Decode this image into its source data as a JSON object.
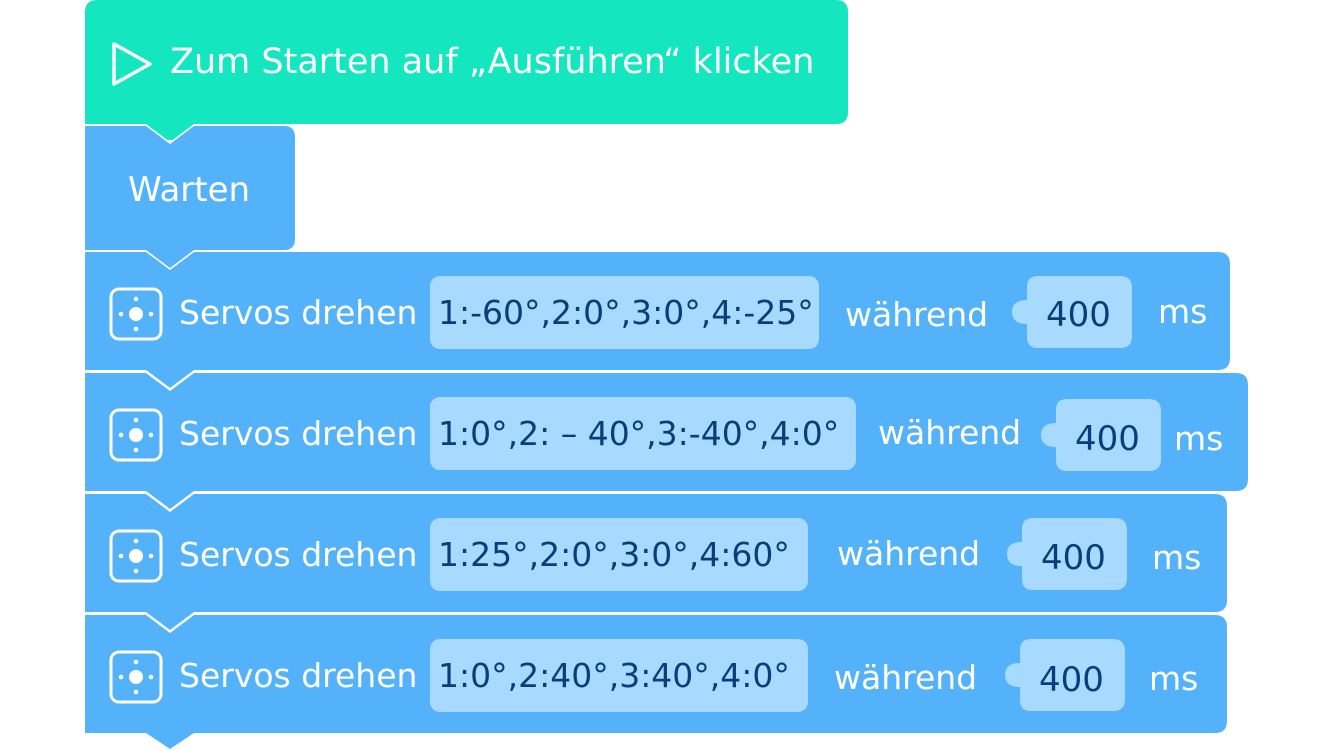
{
  "start_block": {
    "label": "Zum Starten auf „Ausführen“ klicken",
    "icon": "play-icon"
  },
  "wait_block": {
    "label": "Warten"
  },
  "servo_blocks": [
    {
      "label": "Servos drehen",
      "angles": "1:-60°,2:0°,3:0°,4:-25°",
      "during": "während",
      "duration": "400",
      "unit": "ms"
    },
    {
      "label": "Servos drehen",
      "angles": "1:0°,2: – 40°,3:-40°,4:0°",
      "during": "während",
      "duration": "400",
      "unit": "ms"
    },
    {
      "label": "Servos drehen",
      "angles": "1:25°,2:0°,3:0°,4:60°",
      "during": "während",
      "duration": "400",
      "unit": "ms"
    },
    {
      "label": "Servos drehen",
      "angles": "1:0°,2:40°,3:40°,4:0°",
      "during": "während",
      "duration": "400",
      "unit": "ms"
    }
  ],
  "colors": {
    "start": "#14e6bf",
    "block": "#54b2fb",
    "input": "#a8daff",
    "input_text": "#0a3d7a"
  }
}
